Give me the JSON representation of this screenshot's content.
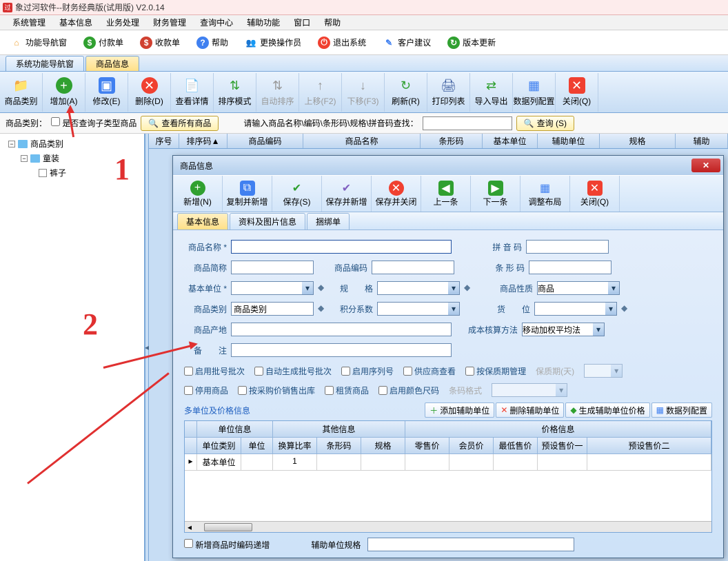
{
  "app": {
    "title": "象过河软件--财务经典版(试用版) V2.0.14"
  },
  "menu": [
    "系统管理",
    "基本信息",
    "业务处理",
    "财务管理",
    "查询中心",
    "辅助功能",
    "窗口",
    "帮助"
  ],
  "buttonbar": [
    {
      "label": "功能导航窗",
      "icon": "home-icon",
      "color": "#f0a030"
    },
    {
      "label": "付款单",
      "icon": "pay-icon",
      "color": "#30a030"
    },
    {
      "label": "收款单",
      "icon": "receive-icon",
      "color": "#d04030"
    },
    {
      "label": "帮助",
      "icon": "help-icon",
      "color": "#4080f0"
    },
    {
      "label": "更换操作员",
      "icon": "user-icon",
      "color": "#f0a030"
    },
    {
      "label": "退出系统",
      "icon": "power-icon",
      "color": "#f04030"
    },
    {
      "label": "客户建议",
      "icon": "note-icon",
      "color": "#4080f0"
    },
    {
      "label": "版本更新",
      "icon": "update-icon",
      "color": "#30a030"
    }
  ],
  "tabs": [
    {
      "label": "系统功能导航窗",
      "active": false
    },
    {
      "label": "商品信息",
      "active": true
    }
  ],
  "toolbar": [
    {
      "label": "商品类别",
      "icon": "folder-icon",
      "color": "#f0c040"
    },
    {
      "label": "增加(A)",
      "icon": "plus-icon",
      "color": "#30a030"
    },
    {
      "label": "修改(E)",
      "icon": "edit-icon",
      "color": "#4080f0"
    },
    {
      "label": "删除(D)",
      "icon": "delete-icon",
      "color": "#f04030"
    },
    {
      "label": "查看详情",
      "icon": "detail-icon",
      "color": "#c0a040"
    },
    {
      "label": "排序模式",
      "icon": "sort-icon",
      "color": "#30a030"
    },
    {
      "label": "自动排序",
      "icon": "autosort-icon",
      "color": "#b0b0b0",
      "disabled": true
    },
    {
      "label": "上移(F2)",
      "icon": "up-icon",
      "color": "#b0b0b0",
      "disabled": true
    },
    {
      "label": "下移(F3)",
      "icon": "down-icon",
      "color": "#b0b0b0",
      "disabled": true
    },
    {
      "label": "刷新(R)",
      "icon": "refresh-icon",
      "color": "#30a030"
    },
    {
      "label": "打印列表",
      "icon": "print-icon",
      "color": "#4060a0"
    },
    {
      "label": "导入导出",
      "icon": "io-icon",
      "color": "#30a030"
    },
    {
      "label": "数据列配置",
      "icon": "cols-icon",
      "color": "#4080f0"
    },
    {
      "label": "关闭(Q)",
      "icon": "close-icon",
      "color": "#f04030"
    }
  ],
  "filter": {
    "cat_label": "商品类别：",
    "sub_chk": "是否查询子类型商品",
    "viewall": "查看所有商品",
    "search_label": "请输入商品名称\\编码\\条形码\\规格\\拼音码查找：",
    "search_btn": "查询 (S)"
  },
  "tree": {
    "root": "商品类别",
    "child1": "童装",
    "child2": "裤子"
  },
  "grid_cols": [
    "序号",
    "排序码",
    "商品编码",
    "商品名称",
    "条形码",
    "基本单位",
    "辅助单位",
    "规格",
    "辅助"
  ],
  "dialog": {
    "title": "商品信息",
    "toolbar": [
      {
        "label": "新增(N)",
        "icon": "plus-icon",
        "color": "#30a030"
      },
      {
        "label": "复制并新增",
        "icon": "copy-icon",
        "color": "#4080f0"
      },
      {
        "label": "保存(S)",
        "icon": "check-icon",
        "color": "#30a030"
      },
      {
        "label": "保存并新增",
        "icon": "checkplus-icon",
        "color": "#8060c0"
      },
      {
        "label": "保存并关闭",
        "icon": "checkclose-icon",
        "color": "#f04030"
      },
      {
        "label": "上一条",
        "icon": "prev-icon",
        "color": "#30a030"
      },
      {
        "label": "下一条",
        "icon": "next-icon",
        "color": "#30a030"
      },
      {
        "label": "调整布局",
        "icon": "layout-icon",
        "color": "#4080f0"
      },
      {
        "label": "关闭(Q)",
        "icon": "close-icon",
        "color": "#f04030"
      }
    ],
    "tabs": [
      {
        "label": "基本信息",
        "active": true
      },
      {
        "label": "资料及图片信息",
        "active": false
      },
      {
        "label": "捆绑单",
        "active": false
      }
    ],
    "labels": {
      "name": "商品名称 *",
      "pinyin": "拼 音 码",
      "short": "商品简称",
      "code": "商品编码",
      "barcode": "条 形 码",
      "unit": "基本单位 *",
      "spec": "规　　格",
      "nature": "商品性质",
      "nature_val": "商品",
      "cat": "商品类别",
      "cat_val": "商品类别",
      "points": "积分系数",
      "loc": "货　　位",
      "origin": "商品产地",
      "costmethod": "成本核算方法",
      "costmethod_val": "移动加权平均法",
      "remark": "备　　注"
    },
    "checks": {
      "batch": "启用批号批次",
      "autobatch": "自动生成批号批次",
      "serial": "启用序列号",
      "vendor": "供应商查看",
      "quality": "按保质期管理",
      "quality_days": "保质期(天)",
      "stop": "停用商品",
      "purchase": "按采购价销售出库",
      "rent": "租赁商品",
      "color": "启用颜色尺码",
      "barcode_fmt": "条码格式"
    },
    "multi_label": "多单位及价格信息",
    "mini_btns": {
      "add": "添加辅助单位",
      "del": "删除辅助单位",
      "gen": "生成辅助单位价格",
      "cols": "数据列配置"
    },
    "grid": {
      "group": [
        "单位信息",
        "其他信息",
        "价格信息"
      ],
      "cols": [
        "单位类别",
        "单位",
        "换算比率",
        "条形码",
        "规格",
        "零售价",
        "会员价",
        "最低售价",
        "预设售价一",
        "预设售价二"
      ],
      "row0": {
        "type": "基本单位",
        "rate": "1"
      }
    },
    "bottom": {
      "auto_code": "新增商品时编码递增",
      "aux_spec": "辅助单位规格"
    }
  },
  "annot": {
    "n1": "1",
    "n2": "2"
  }
}
